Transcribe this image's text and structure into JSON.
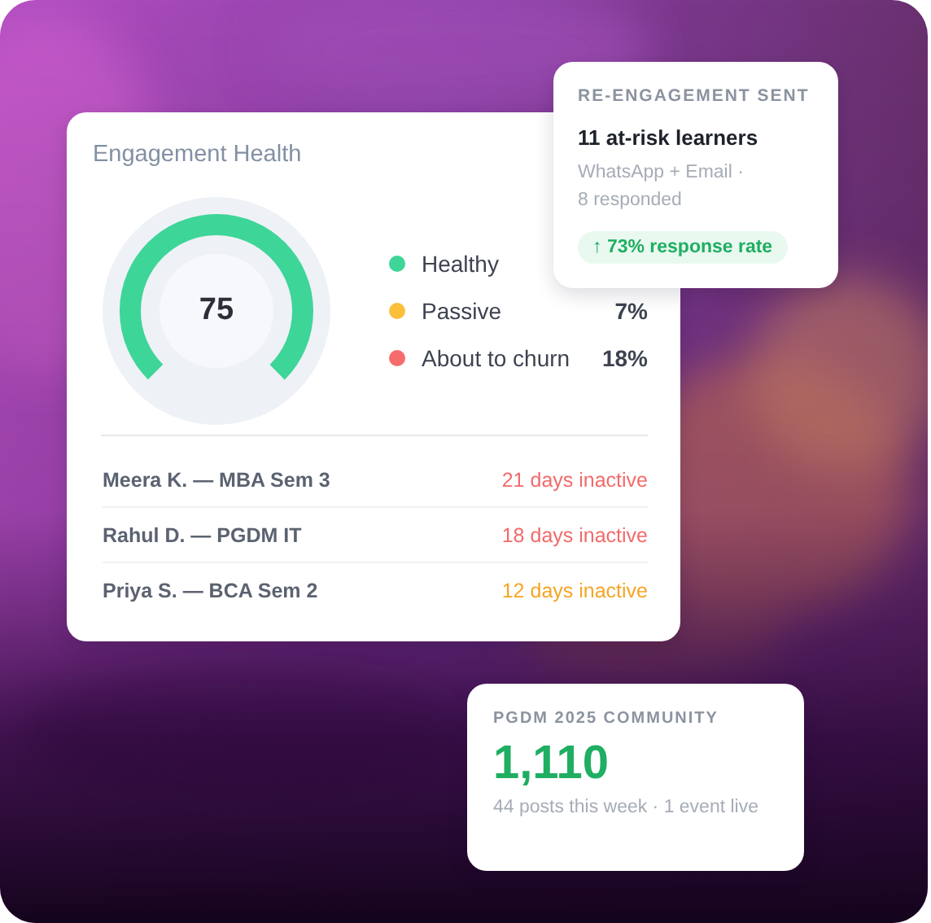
{
  "engagement_health": {
    "title": "Engagement Health",
    "gauge": {
      "score": "75",
      "level": 0.75
    },
    "segments": [
      {
        "label": "Healthy",
        "color": "#3ed598"
      },
      {
        "label": "Passive",
        "value": "7%",
        "color": "#fbbf39"
      },
      {
        "label": "About to churn",
        "value": "18%",
        "color": "#f76c6c"
      }
    ],
    "learners": [
      {
        "name": "Meera K. — MBA Sem 3",
        "status": "21 days inactive",
        "color": "#f26b6b"
      },
      {
        "name": "Rahul D. — PGDM IT",
        "status": "18 days inactive",
        "color": "#f26b6b"
      },
      {
        "name": "Priya S. — BCA Sem 2",
        "status": "12 days inactive",
        "color": "#f5a524"
      }
    ]
  },
  "re_engagement": {
    "label": "RE-ENGAGEMENT SENT",
    "title": "11 at-risk learners",
    "detail": "WhatsApp + Email · 8 responded",
    "badge": "↑ 73% response rate"
  },
  "community": {
    "label": "PGDM 2025 COMMUNITY",
    "count": "1,110",
    "detail": "44 posts this week · 1 event live"
  }
}
